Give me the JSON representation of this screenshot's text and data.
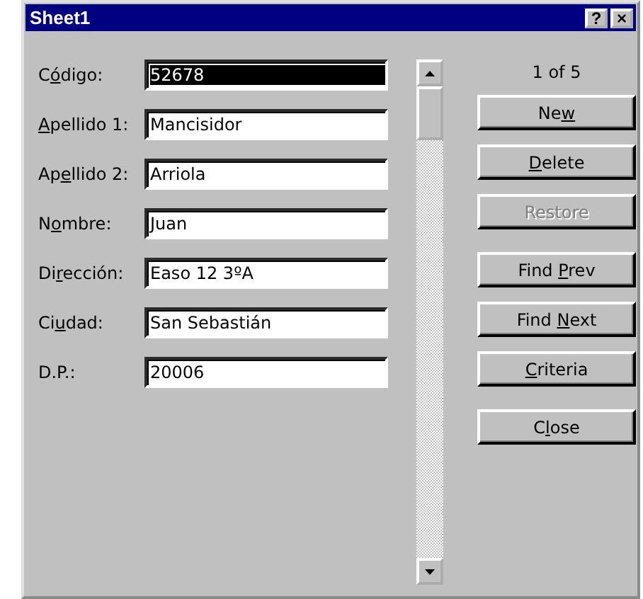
{
  "window": {
    "title": "Sheet1",
    "title_buttons": [
      "?",
      "×"
    ]
  },
  "fields": [
    {
      "label": {
        "before": "C",
        "key": "ó",
        "after": "digo:"
      },
      "value": "52678",
      "text_selected": true
    },
    {
      "label": {
        "key": "A",
        "after": "pellido 1:"
      },
      "value": "Mancisidor",
      "text_selected": false
    },
    {
      "label": {
        "before": "Ap",
        "key": "e",
        "after": "llido 2:"
      },
      "value": "Arriola",
      "text_selected": false
    },
    {
      "label": {
        "before": "N",
        "key": "o",
        "after": "mbre:"
      },
      "value": "Juan",
      "text_selected": false
    },
    {
      "label": {
        "before": "Di",
        "key": "r",
        "after": "ección:"
      },
      "value": "Easo 12 3ºA",
      "text_selected": false
    },
    {
      "label": {
        "before": "Ci",
        "key": "u",
        "after": "dad:"
      },
      "value": "San Sebastián",
      "text_selected": false
    },
    {
      "label": {
        "before": "D.P.:"
      },
      "value": "20006",
      "text_selected": false
    }
  ],
  "record_counter": "1 of 5",
  "button_groups": [
    [
      {
        "label": {
          "before": "Ne",
          "key": "w"
        },
        "disabled": false
      },
      {
        "label": {
          "key": "D",
          "after": "elete"
        },
        "disabled": false
      },
      {
        "label": {
          "before": "Restore"
        },
        "disabled": true
      }
    ],
    [
      {
        "label": {
          "before": "Find ",
          "key": "P",
          "after": "rev"
        },
        "disabled": false
      },
      {
        "label": {
          "before": "Find ",
          "key": "N",
          "after": "ext"
        },
        "disabled": false
      },
      {
        "label": {
          "key": "C",
          "after": "riteria"
        },
        "disabled": false
      }
    ],
    [
      {
        "label": {
          "before": "C",
          "key": "l",
          "after": "ose"
        },
        "disabled": false
      }
    ]
  ]
}
